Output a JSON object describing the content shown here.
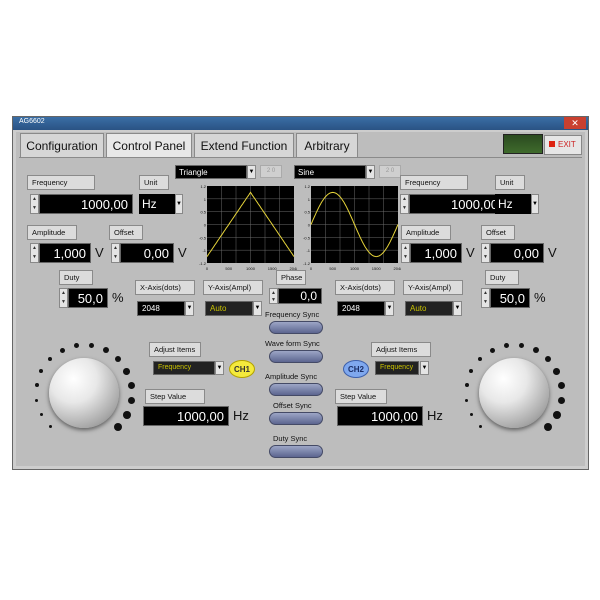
{
  "window": {
    "title": "AG6602",
    "close_symbol": "✕"
  },
  "tabs": [
    "Configuration",
    "Control Panel",
    "Extend Function",
    "Arbitrary"
  ],
  "exit_label": "EXIT",
  "ch1": {
    "frequency_label": "Frequency",
    "frequency_value": "1000,00",
    "unit_label": "Unit",
    "unit_value": "Hz",
    "amplitude_label": "Amplitude",
    "amplitude_value": "1,000",
    "amplitude_unit": "V",
    "offset_label": "Offset",
    "offset_value": "0,00",
    "offset_unit": "V",
    "duty_label": "Duty",
    "duty_value": "50,0",
    "duty_unit": "%",
    "xaxis_label": "X-Axis(dots)",
    "xaxis_value": "2048",
    "yaxis_label": "Y-Axis(Ampl)",
    "yaxis_value": "Auto",
    "waveform": "Triangle",
    "waveform_sub": "2 0",
    "adjust_label": "Adjust Items",
    "adjust_value": "Frequency",
    "badge": "CH1",
    "step_label": "Step Value",
    "step_value": "1000,00",
    "step_unit": "Hz"
  },
  "ch2": {
    "frequency_label": "Frequency",
    "frequency_value": "1000,00",
    "unit_label": "Unit",
    "unit_value": "Hz",
    "amplitude_label": "Amplitude",
    "amplitude_value": "1,000",
    "amplitude_unit": "V",
    "offset_label": "Offset",
    "offset_value": "0,00",
    "offset_unit": "V",
    "duty_label": "Duty",
    "duty_value": "50,0",
    "duty_unit": "%",
    "xaxis_label": "X-Axis(dots)",
    "xaxis_value": "2048",
    "yaxis_label": "Y-Axis(Ampl)",
    "yaxis_value": "Auto",
    "waveform": "Sine",
    "waveform_sub": "2 0",
    "adjust_label": "Adjust Items",
    "adjust_value": "Frequency",
    "badge": "CH2",
    "step_label": "Step Value",
    "step_value": "1000,00",
    "step_unit": "Hz"
  },
  "center": {
    "phase_label": "Phase",
    "phase_value": "0,0",
    "sync": [
      "Frequency Sync",
      "Wave form Sync",
      "Amplitude Sync",
      "Offset Sync",
      "Duty Sync"
    ]
  },
  "graph_ticks": {
    "y": [
      "1.2",
      "1",
      "0.5",
      "0",
      "-0.5",
      "-1",
      "-1.2"
    ],
    "x": [
      "0",
      "500",
      "1000",
      "1500",
      "2048"
    ]
  },
  "colors": {
    "trace": "#e6d43a",
    "panel": "#bdbdbd",
    "grid": "#6a6a6a"
  }
}
